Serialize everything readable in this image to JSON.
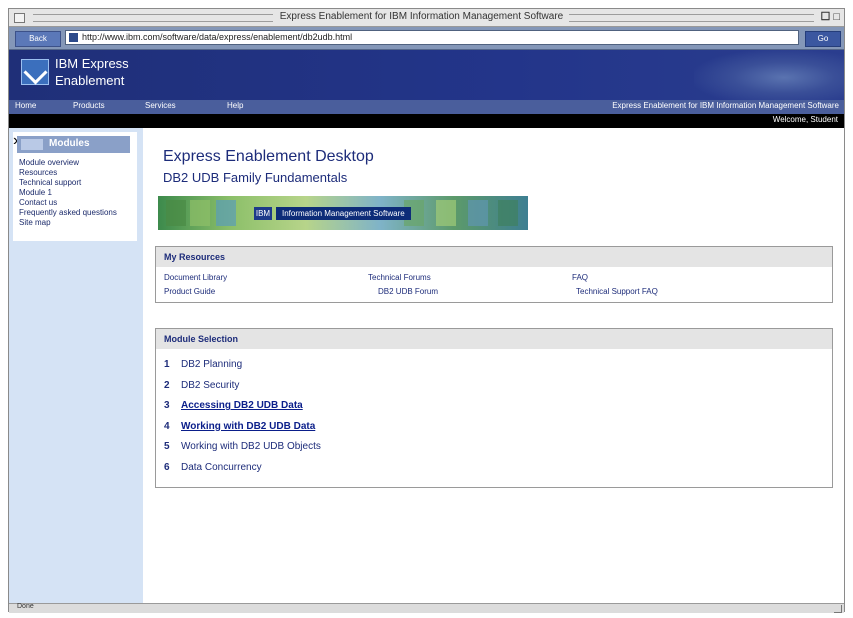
{
  "window": {
    "title": "Express Enablement for IBM Information Management Software",
    "zoom_glyph": "☐ □"
  },
  "browser": {
    "back_label": "Back",
    "address": "http://www.ibm.com/software/data/express/enablement/db2udb.html",
    "go_label": "Go"
  },
  "banner": {
    "brand_line1": "IBM Express",
    "brand_line2": "Enablement"
  },
  "nav": {
    "items": [
      "Home",
      "Products",
      "Services",
      "Help"
    ],
    "right_text": "Express Enablement for IBM Information Management Software",
    "subbar_text": "Welcome, Student"
  },
  "sidebar": {
    "header": "Modules",
    "items": [
      "Module overview",
      "Resources",
      "Technical support",
      "Module 1",
      "Contact us",
      "Frequently asked questions",
      "Site map"
    ]
  },
  "main": {
    "title": "Express Enablement Desktop",
    "subtitle": "DB2 UDB Family Fundamentals",
    "promo_badge": "IBM",
    "promo_text": "Information Management Software"
  },
  "resources": {
    "header": "My Resources",
    "col1_label": "Document Library",
    "col1_value": "Product Guide",
    "col2_label": "Technical Forums",
    "col2_value": "DB2 UDB Forum",
    "col3_label": "FAQ",
    "col3_value": "Technical Support FAQ"
  },
  "modules": {
    "header": "Module Selection",
    "items": [
      {
        "num": "1",
        "name": "DB2 Planning"
      },
      {
        "num": "2",
        "name": "DB2 Security"
      },
      {
        "num": "3",
        "name": "Accessing DB2 UDB Data"
      },
      {
        "num": "4",
        "name": "Working with DB2 UDB Data"
      },
      {
        "num": "5",
        "name": "Working with DB2 UDB Objects"
      },
      {
        "num": "6",
        "name": "Data Concurrency"
      }
    ]
  },
  "status": {
    "text": "Done"
  }
}
